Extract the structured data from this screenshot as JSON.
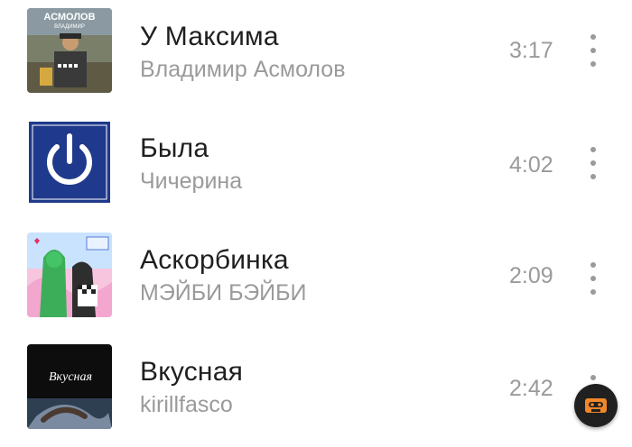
{
  "tracks": [
    {
      "title": "У Максима",
      "artist": "Владимир Асмолов",
      "duration": "3:17",
      "cover_icon": "album-cover-asmolov"
    },
    {
      "title": "Была",
      "artist": "Чичерина",
      "duration": "4:02",
      "cover_icon": "power-icon-cover"
    },
    {
      "title": "Аскорбинка",
      "artist": "МЭЙБИ БЭЙБИ",
      "duration": "2:09",
      "cover_icon": "album-cover-illustration"
    },
    {
      "title": "Вкусная",
      "artist": "kirillfasco",
      "duration": "2:42",
      "cover_icon": "album-cover-vkusnaya"
    }
  ],
  "covers": {
    "asmolov_text_top": "АСМОЛОВ",
    "asmolov_text_sub": "ВЛАДИМИР"
  },
  "fab": {
    "icon": "cassette-icon",
    "accent": "#f0872a"
  },
  "colors": {
    "title": "#1f1f1f",
    "secondary": "#9a9a9a",
    "background": "#ffffff"
  }
}
